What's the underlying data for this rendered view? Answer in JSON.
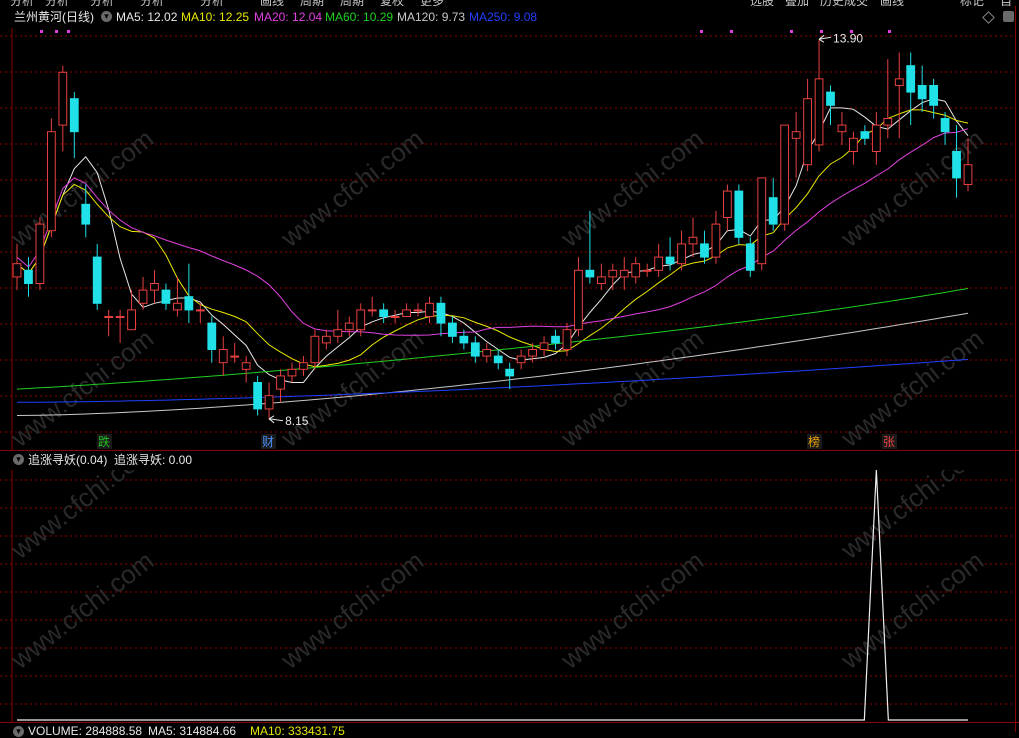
{
  "topbar": {
    "fragments": [
      "分析",
      "分析",
      "分析",
      "分析",
      "分析",
      "画线",
      "周期",
      "周期",
      "复权",
      "更多",
      "选股",
      "叠加",
      "历史成交",
      "画线",
      "标记",
      "自选"
    ]
  },
  "main_header": {
    "stock_name": "兰州黄河(日线)",
    "ma5": "MA5: 12.02",
    "ma10": "MA10: 12.25",
    "ma20": "MA20: 12.04",
    "ma60": "MA60: 10.29",
    "ma120": "MA120: 9.73",
    "ma250": "MA250: 9.08"
  },
  "colors": {
    "ma5": "#e8e8e8",
    "ma10": "#e8e800",
    "ma20": "#e040e0",
    "ma60": "#20d020",
    "ma120": "#c8c8c8",
    "ma250": "#2040ff",
    "up": "#e84040",
    "down": "#20e0e8",
    "grid": "#8b0000",
    "panel_bg": "#000000"
  },
  "price_labels": {
    "high": "13.90",
    "low": "8.15"
  },
  "event_flags": [
    {
      "text": "跌",
      "color": "#20c020"
    },
    {
      "text": "财",
      "color": "#4a90ff"
    },
    {
      "text": "榜",
      "color": "#e8a000"
    },
    {
      "text": "张",
      "color": "#e84040"
    }
  ],
  "indicator_header": {
    "name": "追涨寻妖(0.04)",
    "value": "追涨寻妖: 0.00"
  },
  "volume_header": {
    "volume": "VOLUME: 284888.58",
    "ma5": "MA5: 314884.66",
    "ma10": "MA10: 333431.75"
  },
  "watermark": "www.cfchi.com",
  "chart_data": {
    "type": "candlestick",
    "title": "兰州黄河(日线)",
    "high_label": 13.9,
    "low_label": 8.15,
    "candles": [
      {
        "o": 10.3,
        "c": 10.5,
        "h": 10.8,
        "l": 10.1
      },
      {
        "o": 10.4,
        "c": 10.2,
        "h": 10.6,
        "l": 10.0
      },
      {
        "o": 10.2,
        "c": 11.1,
        "h": 11.2,
        "l": 10.1
      },
      {
        "o": 11.0,
        "c": 12.5,
        "h": 12.7,
        "l": 10.9
      },
      {
        "o": 12.6,
        "c": 13.4,
        "h": 13.5,
        "l": 12.2
      },
      {
        "o": 13.0,
        "c": 12.5,
        "h": 13.1,
        "l": 12.1
      },
      {
        "o": 11.4,
        "c": 11.1,
        "h": 11.7,
        "l": 10.9
      },
      {
        "o": 10.6,
        "c": 9.9,
        "h": 10.8,
        "l": 9.8
      },
      {
        "o": 9.7,
        "c": 9.7,
        "h": 9.8,
        "l": 9.4
      },
      {
        "o": 9.7,
        "c": 9.7,
        "h": 9.8,
        "l": 9.3
      },
      {
        "o": 9.5,
        "c": 9.8,
        "h": 10.1,
        "l": 9.5
      },
      {
        "o": 9.9,
        "c": 10.1,
        "h": 10.3,
        "l": 9.8
      },
      {
        "o": 10.1,
        "c": 10.2,
        "h": 10.4,
        "l": 9.9
      },
      {
        "o": 10.1,
        "c": 9.9,
        "h": 10.2,
        "l": 9.8
      },
      {
        "o": 9.8,
        "c": 9.9,
        "h": 10.3,
        "l": 9.7
      },
      {
        "o": 10.0,
        "c": 9.8,
        "h": 10.5,
        "l": 9.6
      },
      {
        "o": 9.8,
        "c": 9.8,
        "h": 9.9,
        "l": 9.6
      },
      {
        "o": 9.6,
        "c": 9.2,
        "h": 9.7,
        "l": 9.0
      },
      {
        "o": 9.0,
        "c": 9.2,
        "h": 9.4,
        "l": 8.8
      },
      {
        "o": 9.1,
        "c": 9.1,
        "h": 9.3,
        "l": 9.0
      },
      {
        "o": 8.9,
        "c": 9.0,
        "h": 9.1,
        "l": 8.7
      },
      {
        "o": 8.7,
        "c": 8.3,
        "h": 8.8,
        "l": 8.2
      },
      {
        "o": 8.3,
        "c": 8.5,
        "h": 8.7,
        "l": 8.15
      },
      {
        "o": 8.6,
        "c": 8.8,
        "h": 8.9,
        "l": 8.4
      },
      {
        "o": 8.8,
        "c": 8.9,
        "h": 9.0,
        "l": 8.7
      },
      {
        "o": 8.9,
        "c": 9.0,
        "h": 9.1,
        "l": 8.8
      },
      {
        "o": 9.0,
        "c": 9.4,
        "h": 9.5,
        "l": 8.9
      },
      {
        "o": 9.3,
        "c": 9.4,
        "h": 9.5,
        "l": 9.2
      },
      {
        "o": 9.4,
        "c": 9.5,
        "h": 9.8,
        "l": 9.3
      },
      {
        "o": 9.5,
        "c": 9.6,
        "h": 9.7,
        "l": 9.4
      },
      {
        "o": 9.5,
        "c": 9.8,
        "h": 9.9,
        "l": 9.4
      },
      {
        "o": 9.8,
        "c": 9.8,
        "h": 10.0,
        "l": 9.7
      },
      {
        "o": 9.8,
        "c": 9.7,
        "h": 9.9,
        "l": 9.6
      },
      {
        "o": 9.7,
        "c": 9.7,
        "h": 9.8,
        "l": 9.6
      },
      {
        "o": 9.7,
        "c": 9.8,
        "h": 9.9,
        "l": 9.7
      },
      {
        "o": 9.8,
        "c": 9.8,
        "h": 9.9,
        "l": 9.7
      },
      {
        "o": 9.7,
        "c": 9.9,
        "h": 10.0,
        "l": 9.6
      },
      {
        "o": 9.9,
        "c": 9.6,
        "h": 10.0,
        "l": 9.4
      },
      {
        "o": 9.6,
        "c": 9.4,
        "h": 9.7,
        "l": 9.3
      },
      {
        "o": 9.4,
        "c": 9.3,
        "h": 9.5,
        "l": 9.2
      },
      {
        "o": 9.3,
        "c": 9.1,
        "h": 9.4,
        "l": 9.0
      },
      {
        "o": 9.1,
        "c": 9.2,
        "h": 9.3,
        "l": 9.0
      },
      {
        "o": 9.1,
        "c": 9.0,
        "h": 9.2,
        "l": 8.9
      },
      {
        "o": 8.9,
        "c": 8.8,
        "h": 9.0,
        "l": 8.6
      },
      {
        "o": 9.0,
        "c": 9.1,
        "h": 9.2,
        "l": 8.9
      },
      {
        "o": 9.1,
        "c": 9.2,
        "h": 9.3,
        "l": 9.0
      },
      {
        "o": 9.2,
        "c": 9.3,
        "h": 9.4,
        "l": 9.1
      },
      {
        "o": 9.4,
        "c": 9.3,
        "h": 9.5,
        "l": 9.2
      },
      {
        "o": 9.2,
        "c": 9.5,
        "h": 9.6,
        "l": 9.1
      },
      {
        "o": 9.5,
        "c": 10.4,
        "h": 10.6,
        "l": 9.4
      },
      {
        "o": 10.4,
        "c": 10.3,
        "h": 11.3,
        "l": 10.2
      },
      {
        "o": 10.2,
        "c": 10.3,
        "h": 10.5,
        "l": 10.1
      },
      {
        "o": 10.3,
        "c": 10.4,
        "h": 10.5,
        "l": 10.1
      },
      {
        "o": 10.3,
        "c": 10.4,
        "h": 10.6,
        "l": 10.1
      },
      {
        "o": 10.3,
        "c": 10.5,
        "h": 10.6,
        "l": 10.2
      },
      {
        "o": 10.4,
        "c": 10.4,
        "h": 10.5,
        "l": 10.3
      },
      {
        "o": 10.4,
        "c": 10.6,
        "h": 10.8,
        "l": 10.3
      },
      {
        "o": 10.6,
        "c": 10.5,
        "h": 10.9,
        "l": 10.4
      },
      {
        "o": 10.5,
        "c": 10.8,
        "h": 11.0,
        "l": 10.4
      },
      {
        "o": 10.8,
        "c": 10.9,
        "h": 11.2,
        "l": 10.6
      },
      {
        "o": 10.8,
        "c": 10.6,
        "h": 11.0,
        "l": 10.5
      },
      {
        "o": 10.6,
        "c": 11.1,
        "h": 11.3,
        "l": 10.5
      },
      {
        "o": 11.2,
        "c": 11.6,
        "h": 11.7,
        "l": 11.0
      },
      {
        "o": 11.6,
        "c": 10.9,
        "h": 11.7,
        "l": 10.8
      },
      {
        "o": 10.8,
        "c": 10.4,
        "h": 10.9,
        "l": 10.3
      },
      {
        "o": 10.5,
        "c": 11.8,
        "h": 11.8,
        "l": 10.4
      },
      {
        "o": 11.5,
        "c": 11.1,
        "h": 11.8,
        "l": 11.0
      },
      {
        "o": 11.1,
        "c": 12.6,
        "h": 12.6,
        "l": 11.0
      },
      {
        "o": 12.4,
        "c": 12.5,
        "h": 12.8,
        "l": 11.8
      },
      {
        "o": 12.0,
        "c": 13.0,
        "h": 13.3,
        "l": 11.9
      },
      {
        "o": 12.3,
        "c": 13.3,
        "h": 13.9,
        "l": 12.2
      },
      {
        "o": 13.1,
        "c": 12.9,
        "h": 13.2,
        "l": 12.6
      },
      {
        "o": 12.5,
        "c": 12.6,
        "h": 12.8,
        "l": 12.3
      },
      {
        "o": 12.2,
        "c": 12.4,
        "h": 12.5,
        "l": 12.0
      },
      {
        "o": 12.5,
        "c": 12.4,
        "h": 12.6,
        "l": 12.3
      },
      {
        "o": 12.2,
        "c": 12.6,
        "h": 12.8,
        "l": 12.0
      },
      {
        "o": 12.6,
        "c": 12.7,
        "h": 13.6,
        "l": 12.4
      },
      {
        "o": 13.2,
        "c": 13.3,
        "h": 13.7,
        "l": 12.4
      },
      {
        "o": 13.5,
        "c": 13.1,
        "h": 13.7,
        "l": 12.6
      },
      {
        "o": 13.2,
        "c": 13.0,
        "h": 13.5,
        "l": 12.8
      },
      {
        "o": 13.2,
        "c": 12.9,
        "h": 13.3,
        "l": 12.7
      },
      {
        "o": 12.7,
        "c": 12.5,
        "h": 12.8,
        "l": 12.3
      },
      {
        "o": 12.2,
        "c": 11.8,
        "h": 12.6,
        "l": 11.5
      },
      {
        "o": 11.7,
        "c": 12.0,
        "h": 12.4,
        "l": 11.6
      }
    ],
    "ma_series": [
      {
        "name": "MA5",
        "value": 12.02
      },
      {
        "name": "MA10",
        "value": 12.25
      },
      {
        "name": "MA20",
        "value": 12.04
      },
      {
        "name": "MA60",
        "value": 10.29
      },
      {
        "name": "MA120",
        "value": 9.73
      },
      {
        "name": "MA250",
        "value": 9.08
      }
    ],
    "indicator": {
      "name": "追涨寻妖",
      "param": 0.04,
      "current_value": 0.0,
      "spike_index": 75,
      "spike_value": 1.0
    }
  }
}
